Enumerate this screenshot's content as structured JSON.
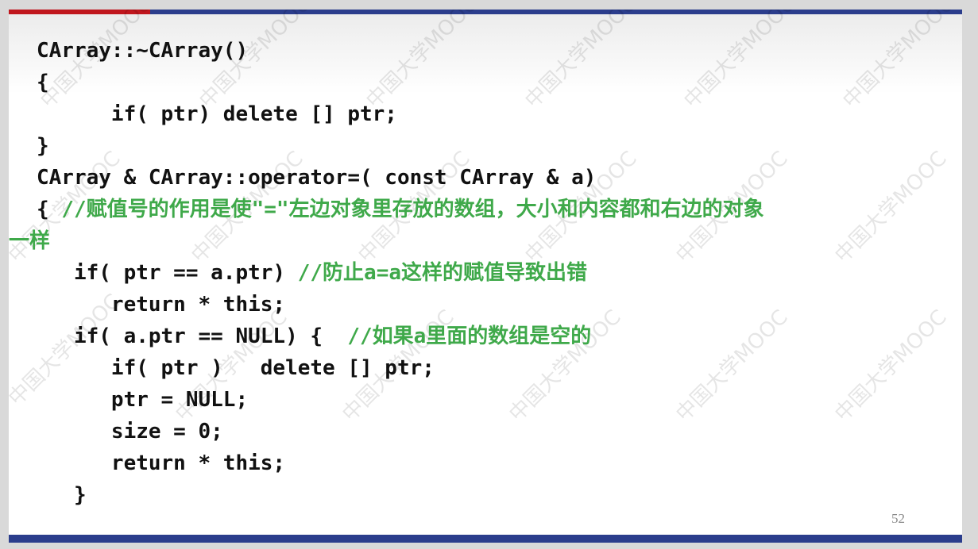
{
  "slide": {
    "watermark": "中国大学MOOC",
    "page_number": "52",
    "colors": {
      "code_text": "#111111",
      "comment": "#3fa94a",
      "top_bar_red": "#c0161d",
      "bar_blue": "#2b3d8c"
    },
    "code_lines": [
      {
        "code": "CArray::~CArray()",
        "comment": ""
      },
      {
        "code": "{",
        "comment": ""
      },
      {
        "code": "      if( ptr) delete [] ptr;",
        "comment": ""
      },
      {
        "code": "}",
        "comment": ""
      },
      {
        "code": "CArray & CArray::operator=( const CArray & a)",
        "comment": ""
      },
      {
        "code": "{ ",
        "comment": "//赋值号的作用是使\"=\"左边对象里存放的数组，大小和内容都和右边的对象"
      },
      {
        "code": "",
        "comment": "一样"
      },
      {
        "code": "   if( ptr == a.ptr) ",
        "comment": "//防止a=a这样的赋值导致出错"
      },
      {
        "code": "      return * this;",
        "comment": ""
      },
      {
        "code": "   if( a.ptr == NULL) {  ",
        "comment": "//如果a里面的数组是空的"
      },
      {
        "code": "      if( ptr )   delete [] ptr;",
        "comment": ""
      },
      {
        "code": "      ptr = NULL;",
        "comment": ""
      },
      {
        "code": "      size = 0;",
        "comment": ""
      },
      {
        "code": "      return * this;",
        "comment": ""
      },
      {
        "code": "   }",
        "comment": ""
      }
    ]
  }
}
